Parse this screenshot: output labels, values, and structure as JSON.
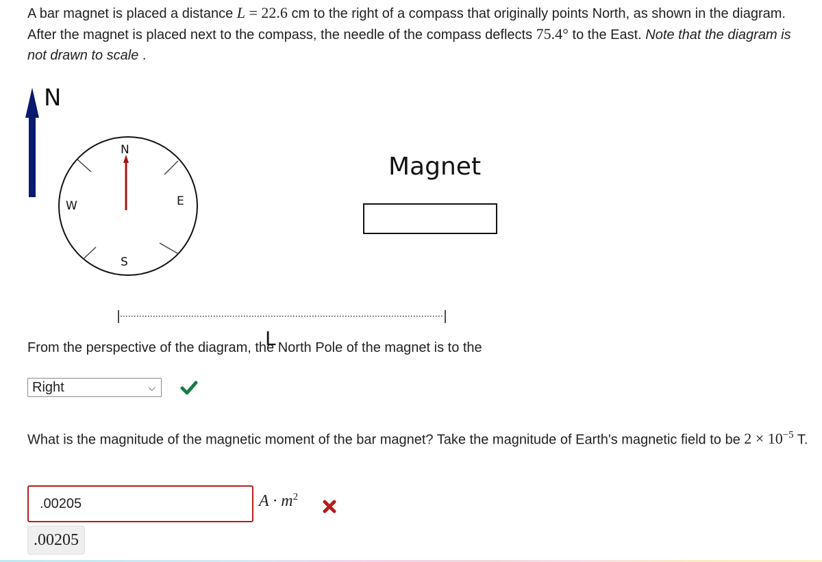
{
  "prompt": {
    "part1": "A bar magnet is placed a distance ",
    "L_var": "L",
    "equals": " = ",
    "L_value": "22.6",
    "part2": " cm to the right of a compass that originally points North, as shown in the diagram. After the magnet is placed next to the compass, the needle of the compass deflects ",
    "angle_value": "75.4°",
    "part3": " to the East. ",
    "note": "Note that the diagram is not drawn to scale",
    "note_end": " ."
  },
  "diagram": {
    "north_arrow_label": "N",
    "compass_labels": {
      "n": "N",
      "e": "E",
      "s": "S",
      "w": "W"
    },
    "magnet_label": "Magnet",
    "distance_label": "L",
    "colors": {
      "north_arrow": "#0a1a6e",
      "needle": "#a31515",
      "outline": "#111111"
    }
  },
  "question1": {
    "text": "From the perspective of the diagram, the North Pole of the magnet is to the",
    "selected": "Right",
    "status": "correct",
    "status_icon": "checkmark-icon",
    "status_color": "#1b7a4a"
  },
  "question2": {
    "text_part1": "What is the magnitude of the magnetic moment of the bar magnet? Take the magnitude of Earth's magnetic field to be ",
    "field_math": "2 × 10",
    "field_exp": "−5",
    "text_part2": " T.",
    "input_value": ".00205",
    "unit_A": "A · m",
    "unit_exp": "2",
    "status": "incorrect",
    "status_icon": "cross-icon",
    "status_color": "#b71c1c",
    "echo_value": ".00205"
  }
}
